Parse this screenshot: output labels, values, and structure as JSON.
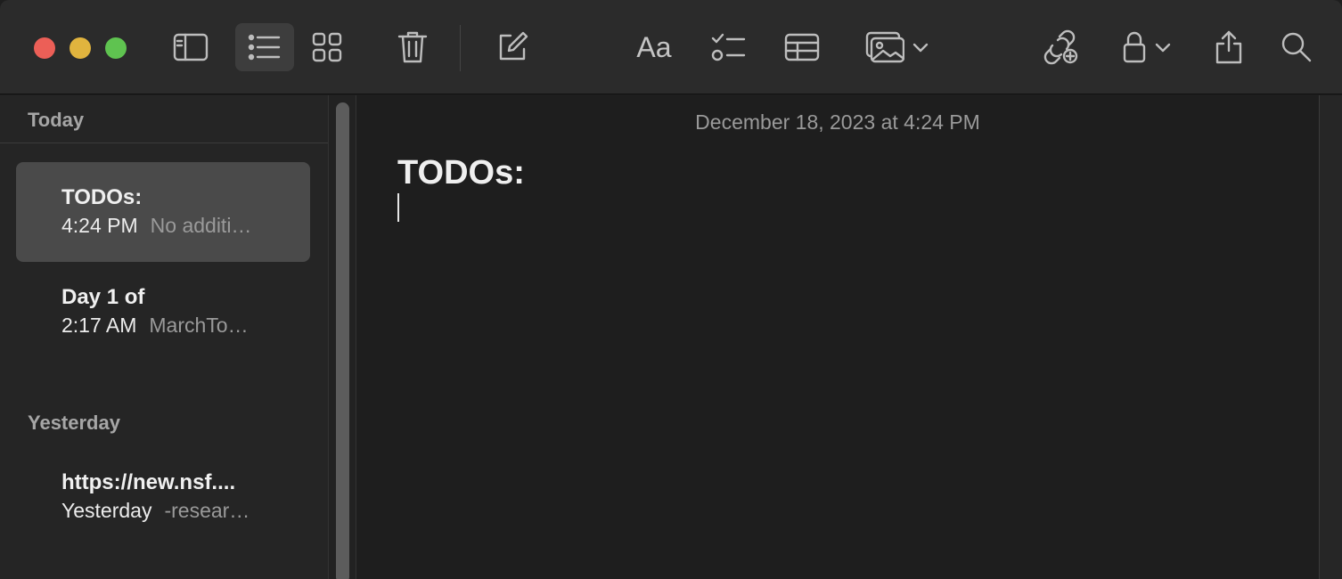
{
  "toolbar": {
    "buttons": [
      "sidebar-toggle",
      "list-view",
      "gallery-view",
      "delete",
      "compose",
      "format",
      "checklist",
      "table",
      "media",
      "collaborate",
      "lock",
      "share",
      "search"
    ],
    "format_label": "Aa"
  },
  "sidebar": {
    "sections": [
      {
        "header": "Today",
        "notes": [
          {
            "title": "TODOs:",
            "time": "4:24 PM",
            "preview": "No additi…",
            "selected": true
          },
          {
            "title": "Day 1 of",
            "time": "2:17 AM",
            "preview": "MarchTo…",
            "selected": false
          }
        ]
      },
      {
        "header": "Yesterday",
        "notes": [
          {
            "title": "https://new.nsf....",
            "time": "Yesterday",
            "preview": "-resear…",
            "selected": false
          }
        ]
      }
    ]
  },
  "editor": {
    "date": "December 18, 2023 at 4:24 PM",
    "heading": "TODOs:"
  },
  "colors": {
    "close": "#ec5f57",
    "minimize": "#e1b43e",
    "maximize": "#5fc350",
    "selected_note": "#4a4a4a"
  }
}
